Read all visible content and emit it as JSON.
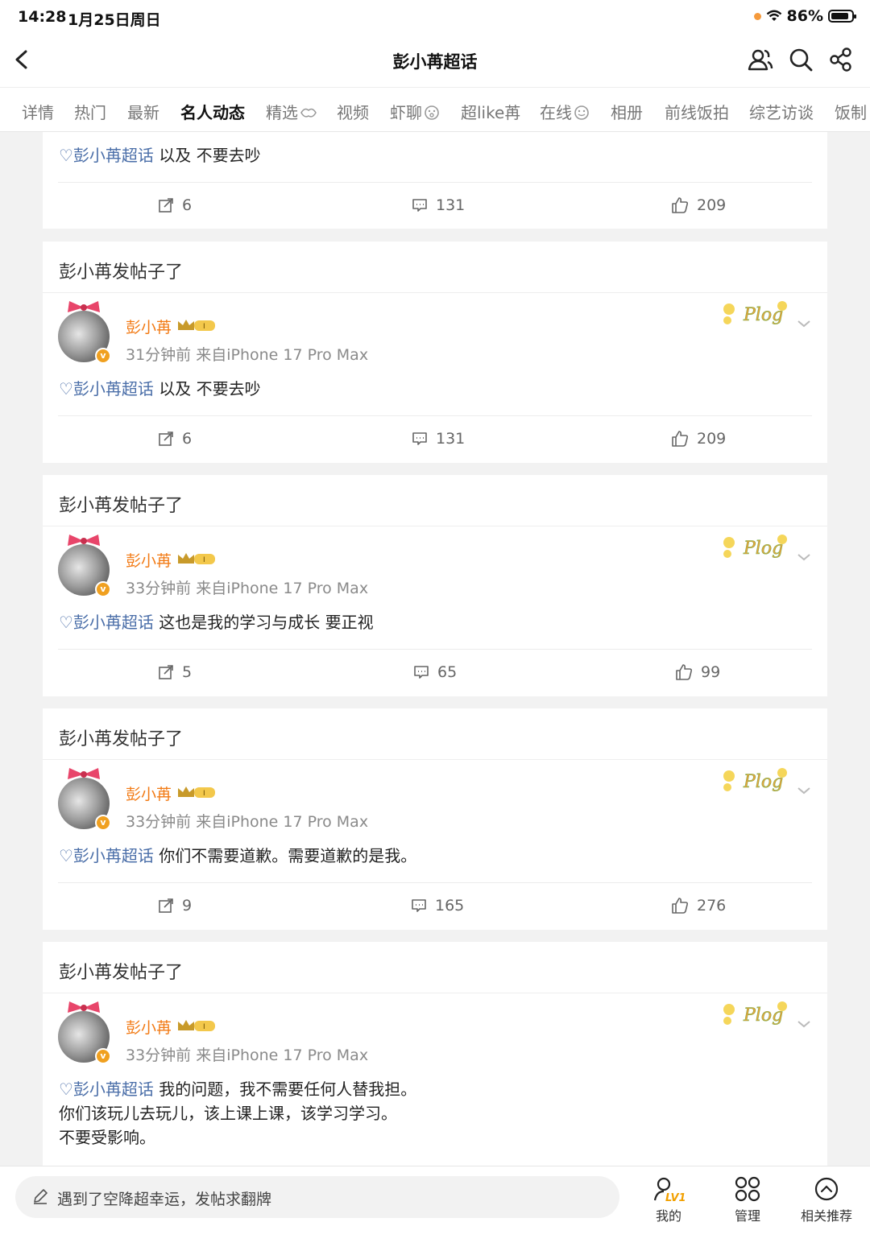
{
  "status": {
    "time": "14:28",
    "date": "1月25日周日",
    "battery": "86%",
    "battery_level": 0.86
  },
  "header": {
    "title": "彭小苒超话"
  },
  "tabs": [
    "详情",
    "热门",
    "最新",
    "名人动态",
    "精选",
    "视频",
    "虾聊",
    "超like苒",
    "在线",
    "相册",
    "前线饭拍",
    "综艺访谈",
    "饭制"
  ],
  "cards": [
    {
      "content_topic": "♡彭小苒超话",
      "content_text": "以及 不要去吵",
      "reposts": "6",
      "comments": "131",
      "likes": "209"
    },
    {
      "title": "彭小苒发帖子了",
      "user": "彭小苒",
      "meta": "31分钟前   来自iPhone 17 Pro Max",
      "content_topic": "♡彭小苒超话",
      "content_text": "以及 不要去吵",
      "reposts": "6",
      "comments": "131",
      "likes": "209"
    },
    {
      "title": "彭小苒发帖子了",
      "user": "彭小苒",
      "meta": "33分钟前   来自iPhone 17 Pro Max",
      "content_topic": "♡彭小苒超话",
      "content_text": "这也是我的学习与成长 要正视",
      "reposts": "5",
      "comments": "65",
      "likes": "99"
    },
    {
      "title": "彭小苒发帖子了",
      "user": "彭小苒",
      "meta": "33分钟前   来自iPhone 17 Pro Max",
      "content_topic": "♡彭小苒超话",
      "content_text": "你们不需要道歉。需要道歉的是我。",
      "reposts": "9",
      "comments": "165",
      "likes": "276"
    },
    {
      "title": "彭小苒发帖子了",
      "user": "彭小苒",
      "meta": "33分钟前   来自iPhone 17 Pro Max",
      "content_topic": "♡彭小苒超话",
      "content_text": "我的问题，我不需要任何人替我担。",
      "content_line2": "你们该玩儿去玩儿，该上课上课，该学习学习。",
      "content_line3": "不要受影响。"
    }
  ],
  "bottom": {
    "placeholder": "遇到了空降超幸运，发帖求翻牌",
    "mine": "我的",
    "manage": "管理",
    "related": "相关推荐",
    "level_badge": "LV1"
  }
}
